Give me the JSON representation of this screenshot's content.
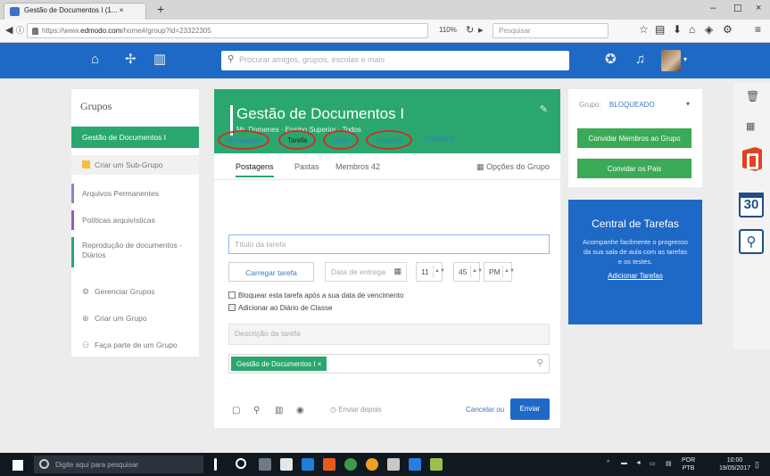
{
  "browser": {
    "tab_title": "Gestão de Documentos I (1... ×",
    "tab_close": "×",
    "new_tab": "+",
    "url_prefix": "https://www.",
    "url_domain": "edmodo.com",
    "url_rest": "/home#/group?id=23322305",
    "zoom": "110%",
    "search_placeholder": "Pesquisar",
    "window_min": "–",
    "window_max": "☐",
    "window_close": "×"
  },
  "app": {
    "search_placeholder": "Procurar amigos, grupos, escolas e mais",
    "brand_color": "#1f69c6",
    "accent_color": "#2aa76f"
  },
  "sidebar": {
    "title": "Grupos",
    "active_group": "Gestão de Documentos I",
    "create_subgroup": "Criar um Sub-Grupo",
    "folders": [
      "Arquivos Permanentes",
      "Políticas arquivísticas",
      "Reprodução de documentos - Diários"
    ],
    "links": [
      {
        "icon": "gear-icon",
        "glyph": "⚙",
        "label": "Gerenciar Grupos"
      },
      {
        "icon": "plus-icon",
        "glyph": "⊕",
        "label": "Criar um Grupo"
      },
      {
        "icon": "group-icon",
        "glyph": "⚇",
        "label": "Faça parte de um Grupo"
      }
    ]
  },
  "group": {
    "title": "Gestão de Documentos I",
    "subtitle": "Mr. Domenes · Ensino Superior · Todos",
    "tabs": {
      "posts": "Postagens",
      "folders": "Pastas",
      "members": "Membros 42",
      "options": "Opções do Grupo"
    }
  },
  "post_types": {
    "message": "Mensagem",
    "assignment": "Tarefa",
    "quiz": "Teste",
    "poll": "Enquete",
    "snapshot": "Snapshot"
  },
  "form": {
    "title_placeholder": "Título da tarefa",
    "load_button": "Carregar tarefa",
    "due_date_placeholder": "Data de entrega",
    "hour": "11",
    "minute": "45",
    "ampm": "PM",
    "lock_label": "Bloquear esta tarefa após a sua data de vencimento",
    "gradebook_label": "Adicionar ao Diário de Classe",
    "description_placeholder": "Descrição da tarefa",
    "recipient_chip": "Gestão de Documentos I ×",
    "draft_label": "Enviar depois",
    "cancel_label": "Cancelar ou",
    "send_label": "Enviar"
  },
  "right_panel": {
    "group_label": "Grupo:",
    "status": "BLOQUEADO",
    "btn_manage": "Convidar Membros ao Grupo",
    "btn_parents": "Convidar os Pais"
  },
  "task_center": {
    "title": "Central de Tarefas",
    "description": "Acompanhe facilmente o progresso da sua sala de aula com as tarefas e os testes.",
    "link": "Adicionar Tarefas"
  },
  "dock": {
    "calendar_day": "30"
  },
  "taskbar": {
    "search_placeholder": "Digite aqui para pesquisar",
    "lang": "POR\nPTB",
    "time": "10:00",
    "date": "19/05/2017"
  }
}
